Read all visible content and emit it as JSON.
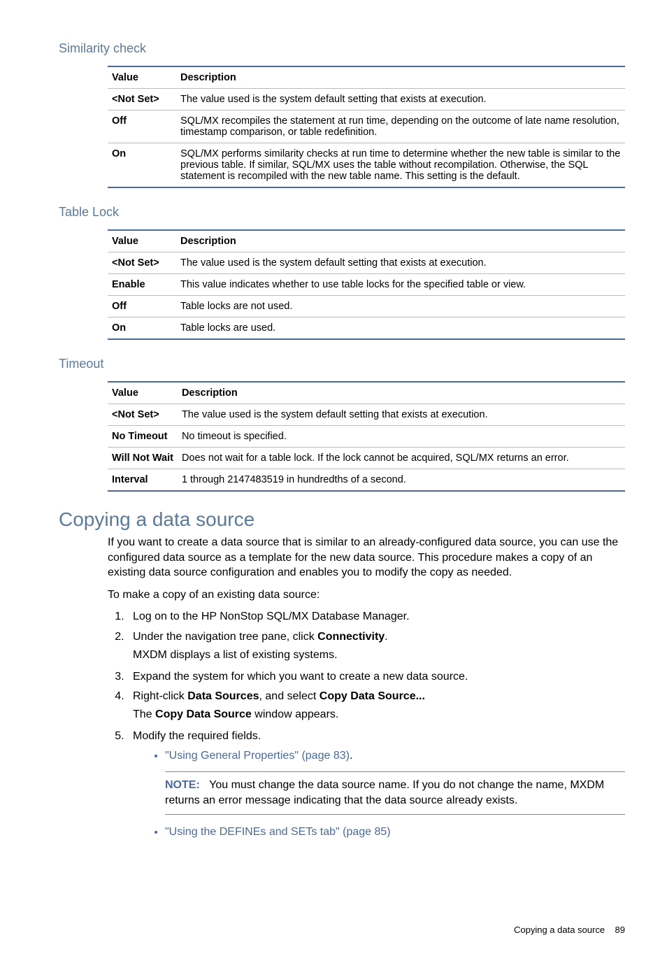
{
  "sections": {
    "s1": {
      "title": "Similarity check",
      "headers": [
        "Value",
        "Description"
      ],
      "rows": [
        {
          "v": "<Not Set>",
          "d": "The value used is the system default setting that exists at execution."
        },
        {
          "v": "Off",
          "d": "SQL/MX recompiles the statement at run time, depending on the outcome of late name resolution, timestamp comparison, or table redefinition."
        },
        {
          "v": "On",
          "d": "SQL/MX performs similarity checks at run time to determine whether the new table is similar to the previous table. If similar, SQL/MX uses the table without recompilation. Otherwise, the SQL statement is recompiled with the new table name. This setting is the default."
        }
      ]
    },
    "s2": {
      "title": "Table Lock",
      "headers": [
        "Value",
        "Description"
      ],
      "rows": [
        {
          "v": "<Not Set>",
          "d": "The value used is the system default setting that exists at execution."
        },
        {
          "v": "Enable",
          "d": "This value indicates whether to use table locks for the specified table or view."
        },
        {
          "v": "Off",
          "d": "Table locks are not used."
        },
        {
          "v": "On",
          "d": "Table locks are used."
        }
      ]
    },
    "s3": {
      "title": "Timeout",
      "headers": [
        "Value",
        "Description"
      ],
      "rows": [
        {
          "v": "<Not Set>",
          "d": "The value used is the system default setting that exists at execution."
        },
        {
          "v": "No Timeout",
          "d": "No timeout is specified."
        },
        {
          "v": "Will Not Wait",
          "d": "Does not wait for a table lock. If the lock cannot be acquired, SQL/MX returns an error."
        },
        {
          "v": "Interval",
          "d": "1 through 2147483519 in hundredths of a second."
        }
      ]
    }
  },
  "copy": {
    "title": "Copying a data source",
    "intro": "If you want to create a data source that is similar to an already-configured data source, you can use the configured data source as a template for the new data source. This procedure makes a copy of an existing data source configuration and enables you to modify the copy as needed.",
    "lead": "To make a copy of an existing data source:",
    "steps": {
      "1": "Log on to the HP NonStop SQL/MX Database Manager.",
      "2a": "Under the navigation tree pane, click ",
      "2b": "Connectivity",
      "2c": ".",
      "2sub": "MXDM displays a list of existing systems.",
      "3": "Expand the system for which you want to create a new data source.",
      "4a": "Right-click ",
      "4b": "Data Sources",
      "4c": ", and select ",
      "4d": "Copy Data Source...",
      "4sub_a": "The ",
      "4sub_b": "Copy Data Source",
      "4sub_c": " window appears.",
      "5": "Modify the required fields.",
      "link1": "\"Using General Properties\" (page 83)",
      "link1_suffix": ".",
      "note_label": "NOTE:",
      "note_text": "You must change the data source name. If you do not change the name, MXDM returns an error message indicating that the data source already exists.",
      "link2": "\"Using the DEFINEs and SETs tab\" (page 85)"
    }
  },
  "footer": {
    "text": "Copying a data source",
    "page": "89"
  }
}
